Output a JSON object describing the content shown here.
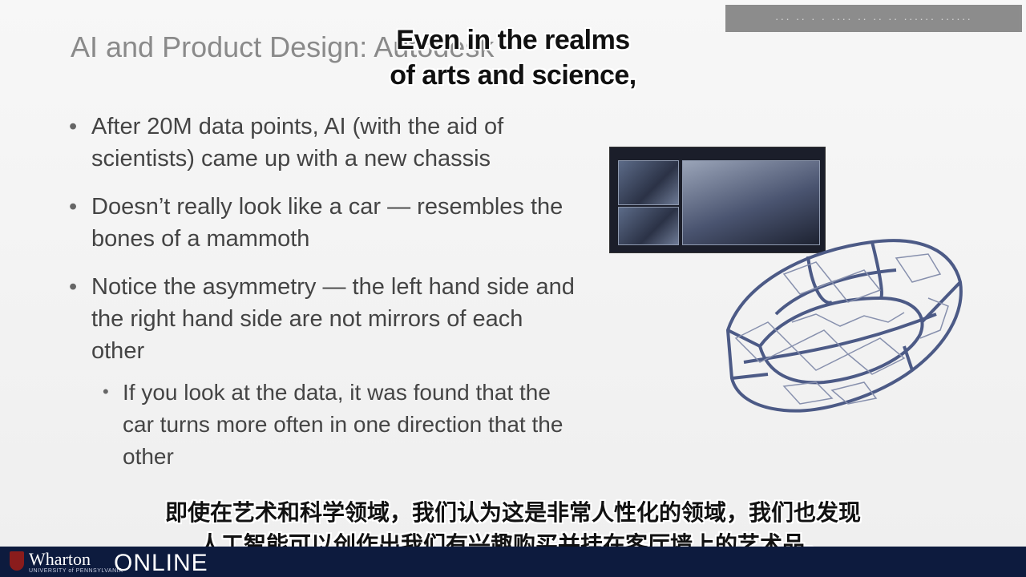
{
  "slide": {
    "title": "AI and Product Design: Autodesk",
    "bullets": [
      {
        "text": "After 20M data points, AI (with the aid of scientists) came up with a new chassis"
      },
      {
        "text": "Doesn’t really look like a car — resembles the bones of a mammoth"
      },
      {
        "text": "Notice the asymmetry — the left hand side and the right hand side are not mirrors of each other"
      }
    ],
    "sub_bullet": "If you look at the data, it was found that the car turns more often in one direction that the other"
  },
  "captions": {
    "english_line1": "Even in the realms",
    "english_line2": "of arts and science,",
    "chinese_line1": "即使在艺术和科学领域，我们认为这是非常人性化的领域，我们也发现",
    "chinese_line2": "人工智能可以创作出我们有兴趣购买并挂在客厅墙上的艺术品。"
  },
  "footer": {
    "brand": "Wharton",
    "brand_sub": "UNIVERSITY of PENNSYLVANIA",
    "online": "ONLINE"
  },
  "watermark_text": "··· ·· · · ···· ·· ·· ·· ······ ······",
  "colors": {
    "footer_bg": "#0d1b3e",
    "title_gray": "#8a8a8a",
    "lattice": "#4c5a86"
  },
  "icons": {
    "bullet": "•"
  }
}
